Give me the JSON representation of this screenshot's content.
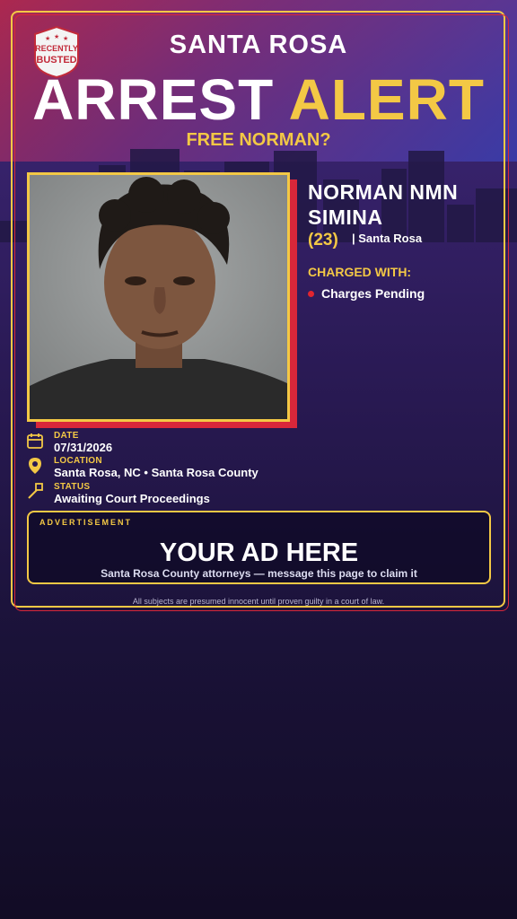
{
  "badge": {
    "line1": "RECENTLY",
    "line2": "BUSTED"
  },
  "header": {
    "city": "SANTA ROSA",
    "headline_part1": "ARREST",
    "headline_part2": "ALERT",
    "subheadline": "FREE NORMAN?"
  },
  "subject": {
    "name_line1": "NORMAN NMN",
    "name_line2": "SIMINA",
    "age": "(23)",
    "city": "| Santa Rosa",
    "charged_label": "CHARGED WITH:",
    "charges": [
      "Charges Pending"
    ]
  },
  "details": {
    "date_label": "DATE",
    "date": "07/31/2026",
    "location_label": "LOCATION",
    "location": "Santa Rosa, NC • Santa Rosa County",
    "status_label": "STATUS",
    "status": "Awaiting Court Proceedings"
  },
  "ad": {
    "tag": "ADVERTISEMENT",
    "title": "YOUR AD HERE",
    "subtitle": "Santa Rosa County attorneys — message this page to claim it"
  },
  "disclaimer": "All subjects are presumed innocent until proven guilty in a court of law.",
  "colors": {
    "accent": "#f3c845",
    "alert_red": "#d8273a",
    "background": "#2a1a55"
  }
}
